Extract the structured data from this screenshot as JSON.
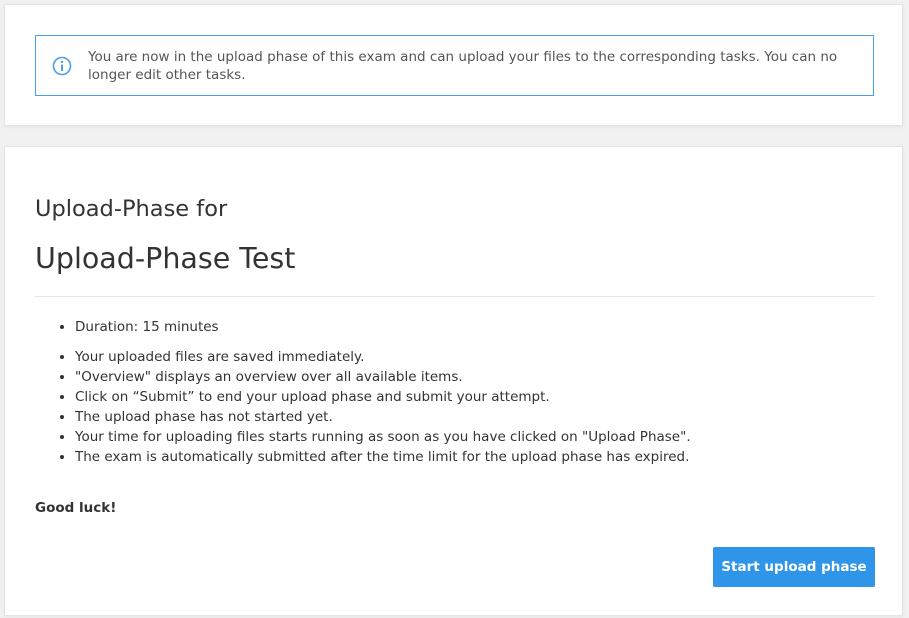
{
  "alert": {
    "icon": "info-icon",
    "accent_color": "#4a9fe6",
    "text": "You are now in the upload phase of this exam and can upload your files to the corresponding tasks. You can no longer edit other tasks."
  },
  "exam": {
    "subtitle": "Upload-Phase for",
    "title": "Upload-Phase Test",
    "duration_items": [
      "Duration: 15 minutes"
    ],
    "rules": [
      "Your uploaded files are saved immediately.",
      "\"Overview\" displays an overview over all available items.",
      "Click on “Submit” to end your upload phase and submit your attempt.",
      "The upload phase has not started yet.",
      "Your time for uploading files starts running as soon as you have clicked on \"Upload Phase\".",
      "The exam is automatically submitted after the time limit for the upload phase has expired."
    ],
    "closing": "Good luck!",
    "start_button_label": "Start upload phase",
    "button_color": "#2f95e8"
  }
}
